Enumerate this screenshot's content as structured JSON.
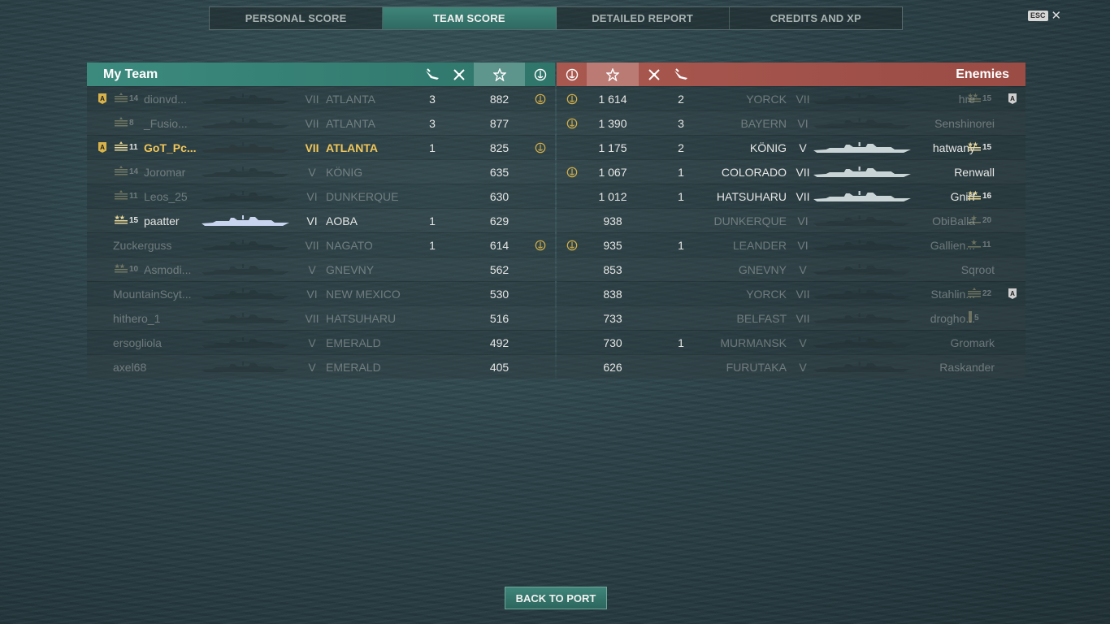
{
  "tabs": [
    {
      "label": "PERSONAL SCORE",
      "active": false
    },
    {
      "label": "TEAM SCORE",
      "active": true
    },
    {
      "label": "DETAILED REPORT",
      "active": false
    },
    {
      "label": "CREDITS AND XP",
      "active": false
    }
  ],
  "close": {
    "key": "ESC",
    "icon": "close-icon"
  },
  "my_team": {
    "title": "My Team",
    "header_icons": [
      "planes-destroyed-icon",
      "ships-destroyed-icon",
      "base-xp-star-icon",
      "captured-bases-icon"
    ],
    "players": [
      {
        "division": "A",
        "rank": "14",
        "name": "dionvd...",
        "tier": "VII",
        "ship": "ATLANTA",
        "planes": "3",
        "kills": "",
        "xp": "882",
        "cap": true,
        "state": "dim",
        "rank_icon": "rank-stripes-icon"
      },
      {
        "division": "",
        "rank": "8",
        "name": "_Fusio...",
        "tier": "VII",
        "ship": "ATLANTA",
        "planes": "3",
        "kills": "",
        "xp": "877",
        "cap": false,
        "state": "dim",
        "rank_icon": "rank-stripes-icon"
      },
      {
        "division": "A",
        "rank": "11",
        "name": "GoT_Pc...",
        "tier": "VII",
        "ship": "ATLANTA",
        "planes": "1",
        "kills": "",
        "xp": "825",
        "cap": true,
        "state": "self",
        "rank_icon": "rank-stripes-icon"
      },
      {
        "division": "",
        "rank": "14",
        "name": "Joromar",
        "tier": "V",
        "ship": "KÖNIG",
        "planes": "",
        "kills": "",
        "xp": "635",
        "cap": false,
        "state": "dim",
        "rank_icon": "rank-stripes-icon"
      },
      {
        "division": "",
        "rank": "11",
        "name": "Leos_25",
        "tier": "VI",
        "ship": "DUNKERQUE",
        "planes": "",
        "kills": "",
        "xp": "630",
        "cap": false,
        "state": "dim",
        "rank_icon": "rank-stripes-icon"
      },
      {
        "division": "",
        "rank": "15",
        "name": "paatter",
        "tier": "VI",
        "ship": "AOBA",
        "planes": "1",
        "kills": "",
        "xp": "629",
        "cap": false,
        "state": "alive",
        "rank_icon": "rank-stars-icon"
      },
      {
        "division": "",
        "rank": "",
        "name": "Zuckerguss",
        "tier": "VII",
        "ship": "NAGATO",
        "planes": "1",
        "kills": "",
        "xp": "614",
        "cap": true,
        "state": "dim",
        "rank_icon": ""
      },
      {
        "division": "",
        "rank": "10",
        "name": "Asmodi...",
        "tier": "V",
        "ship": "GNEVNY",
        "planes": "",
        "kills": "",
        "xp": "562",
        "cap": false,
        "state": "dim",
        "rank_icon": "rank-stars-icon"
      },
      {
        "division": "",
        "rank": "",
        "name": "MountainScyt...",
        "tier": "VI",
        "ship": "NEW MEXICO",
        "planes": "",
        "kills": "",
        "xp": "530",
        "cap": false,
        "state": "dim",
        "rank_icon": ""
      },
      {
        "division": "",
        "rank": "",
        "name": "hithero_1",
        "tier": "VII",
        "ship": "HATSUHARU",
        "planes": "",
        "kills": "",
        "xp": "516",
        "cap": false,
        "state": "dim",
        "rank_icon": ""
      },
      {
        "division": "",
        "rank": "",
        "name": "ersogliola",
        "tier": "V",
        "ship": "EMERALD",
        "planes": "",
        "kills": "",
        "xp": "492",
        "cap": false,
        "state": "dim",
        "rank_icon": ""
      },
      {
        "division": "",
        "rank": "",
        "name": "axel68",
        "tier": "V",
        "ship": "EMERALD",
        "planes": "",
        "kills": "",
        "xp": "405",
        "cap": false,
        "state": "dim",
        "rank_icon": ""
      }
    ]
  },
  "enemies": {
    "title": "Enemies",
    "header_icons": [
      "captured-bases-icon",
      "base-xp-star-icon",
      "ships-destroyed-icon",
      "planes-destroyed-icon"
    ],
    "players": [
      {
        "cap": true,
        "xp": "1 614",
        "kills": "",
        "planes": "2",
        "ship": "YORCK",
        "tier": "VII",
        "name": "hre",
        "rank": "15",
        "division": "A",
        "state": "dim",
        "rank_icon": "rank-stars-icon"
      },
      {
        "cap": true,
        "xp": "1 390",
        "kills": "",
        "planes": "3",
        "ship": "BAYERN",
        "tier": "VI",
        "name": "Senshinorei",
        "rank": "",
        "division": "",
        "state": "dim",
        "rank_icon": ""
      },
      {
        "cap": false,
        "xp": "1 175",
        "kills": "",
        "planes": "2",
        "ship": "KÖNIG",
        "tier": "V",
        "name": "hatwany",
        "rank": "15",
        "division": "",
        "state": "alive",
        "rank_icon": "rank-stars-icon"
      },
      {
        "cap": true,
        "xp": "1 067",
        "kills": "",
        "planes": "1",
        "ship": "COLORADO",
        "tier": "VII",
        "name": "Renwall",
        "rank": "",
        "division": "",
        "state": "alive",
        "rank_icon": ""
      },
      {
        "cap": false,
        "xp": "1 012",
        "kills": "",
        "planes": "1",
        "ship": "HATSUHARU",
        "tier": "VII",
        "name": "Gnirf",
        "rank": "16",
        "division": "",
        "state": "alive",
        "rank_icon": "rank-stars-icon"
      },
      {
        "cap": false,
        "xp": "938",
        "kills": "",
        "planes": "",
        "ship": "DUNKERQUE",
        "tier": "VI",
        "name": "ObiBalla",
        "rank": "20",
        "division": "",
        "state": "dim",
        "rank_icon": "rank-star-icon"
      },
      {
        "cap": true,
        "xp": "935",
        "kills": "",
        "planes": "1",
        "ship": "LEANDER",
        "tier": "VI",
        "name": "Gallien...",
        "rank": "11",
        "division": "",
        "state": "dim",
        "rank_icon": "rank-star-icon"
      },
      {
        "cap": false,
        "xp": "853",
        "kills": "",
        "planes": "",
        "ship": "GNEVNY",
        "tier": "V",
        "name": "Sqroot",
        "rank": "",
        "division": "",
        "state": "dim",
        "rank_icon": ""
      },
      {
        "cap": false,
        "xp": "838",
        "kills": "",
        "planes": "",
        "ship": "YORCK",
        "tier": "VII",
        "name": "Stahlin...",
        "rank": "22",
        "division": "A",
        "state": "dim",
        "rank_icon": "rank-stripes-icon"
      },
      {
        "cap": false,
        "xp": "733",
        "kills": "",
        "planes": "",
        "ship": "BELFAST",
        "tier": "VII",
        "name": "drogho...",
        "rank": "5",
        "division": "",
        "state": "dim",
        "rank_icon": "rank-bar-icon"
      },
      {
        "cap": false,
        "xp": "730",
        "kills": "",
        "planes": "1",
        "ship": "MURMANSK",
        "tier": "V",
        "name": "Gromark",
        "rank": "",
        "division": "",
        "state": "dim",
        "rank_icon": ""
      },
      {
        "cap": false,
        "xp": "626",
        "kills": "",
        "planes": "",
        "ship": "FURUTAKA",
        "tier": "V",
        "name": "Raskander",
        "rank": "",
        "division": "",
        "state": "dim",
        "rank_icon": ""
      }
    ]
  },
  "footer": {
    "back_label": "BACK TO PORT"
  },
  "colors": {
    "my_team": "#3c8a7e",
    "enemies": "#a9584f",
    "self_highlight": "#f2c75a"
  }
}
